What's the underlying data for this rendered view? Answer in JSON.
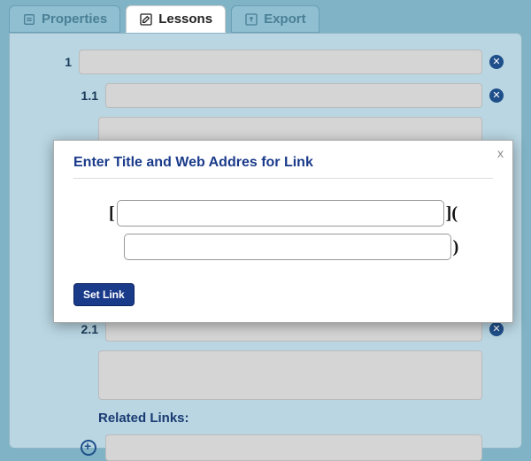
{
  "tabs": {
    "properties": "Properties",
    "lessons": "Lessons",
    "export": "Export"
  },
  "outline": {
    "item1": "1",
    "item1_1": "1.1",
    "item2_1": "2.1"
  },
  "related_label": "Related Links:",
  "modal": {
    "title": "Enter Title and Web Addres for Link",
    "close": "x",
    "bracket_open": "[",
    "bracket_close_paren": "](",
    "paren_close": ")",
    "title_value": "",
    "url_value": "",
    "button": "Set Link"
  }
}
